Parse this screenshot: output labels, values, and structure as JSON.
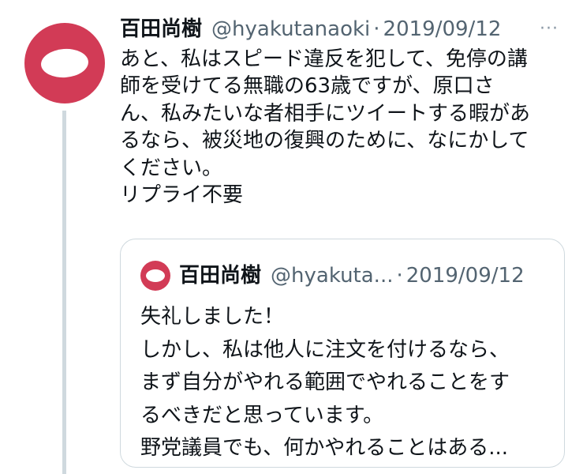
{
  "tweet": {
    "author_name": "百田尚樹",
    "author_handle": "@hyakutanaoki",
    "separator": "·",
    "date": "2019/09/12",
    "more_menu": "···",
    "body_lines": [
      "あと、私はスピード違反を犯して、免停の講",
      "師を受けてる無職の63歳ですが、原口さ",
      "ん、私みたいな者相手にツイートする暇があ",
      "るなら、被災地の復興のために、なにかして",
      "ください。",
      "リプライ不要"
    ]
  },
  "quoted_tweet": {
    "author_name": "百田尚樹",
    "author_handle": "@hyakuta...",
    "separator": "·",
    "date": "2019/09/12",
    "body_lines": [
      "失礼しました！",
      "しかし、私は他人に注文を付けるなら、",
      "まず自分がやれる範囲でやれることをす",
      "るべきだと思っています。",
      "野党議員でも、何かやれることはある..."
    ]
  },
  "colors": {
    "avatar": "#d23b56",
    "secondary_text": "#536471",
    "thread_line": "#cfd9de",
    "border": "#cfd9de"
  }
}
